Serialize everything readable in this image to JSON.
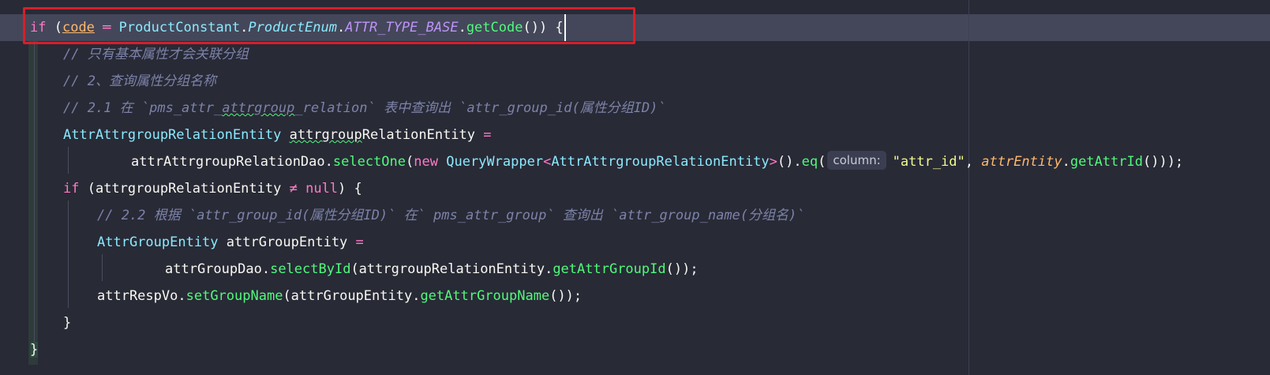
{
  "editor": {
    "lines": [
      {
        "indent": 38,
        "tokens": [
          {
            "text": "if",
            "cls": "kw"
          },
          {
            "text": " (",
            "cls": "plain"
          },
          {
            "text": "code",
            "cls": "var-code"
          },
          {
            "text": " ═ ",
            "cls": "kw"
          },
          {
            "text": "ProductConstant",
            "cls": "cls"
          },
          {
            "text": ".",
            "cls": "plain"
          },
          {
            "text": "ProductEnum",
            "cls": "cls-it"
          },
          {
            "text": ".",
            "cls": "plain"
          },
          {
            "text": "ATTR_TYPE_BASE",
            "cls": "fld"
          },
          {
            "text": ".",
            "cls": "plain"
          },
          {
            "text": "getCode",
            "cls": "fn"
          },
          {
            "text": "()) ",
            "cls": "plain"
          },
          {
            "text": "{",
            "cls": "caret-brace"
          }
        ]
      },
      {
        "indent": 80,
        "tokens": [
          {
            "text": "// 只有基本属性才会关联分组",
            "cls": "cmt"
          }
        ]
      },
      {
        "indent": 80,
        "tokens": [
          {
            "text": "// 2、查询属性分组名称",
            "cls": "cmt"
          }
        ]
      },
      {
        "indent": 80,
        "tokens": [
          {
            "text": "// 2.1 在 `pms_attr_",
            "cls": "cmt"
          },
          {
            "text": "attrgroup",
            "cls": "cmt typo"
          },
          {
            "text": "_relation` 表中查询出 `attr_group_id(属性分组ID)`",
            "cls": "cmt"
          }
        ]
      },
      {
        "indent": 80,
        "tokens": [
          {
            "text": "AttrAttrgroupRelationEntity",
            "cls": "cls"
          },
          {
            "text": " ",
            "cls": "plain"
          },
          {
            "text": "attrgroup",
            "cls": "plain typo"
          },
          {
            "text": "RelationEntity",
            "cls": "plain"
          },
          {
            "text": " =",
            "cls": "kw"
          }
        ]
      },
      {
        "indent": 166,
        "tokens": [
          {
            "text": "attrAttrgroupRelationDao",
            "cls": "plain"
          },
          {
            "text": ".",
            "cls": "plain"
          },
          {
            "text": "selectOne",
            "cls": "fn"
          },
          {
            "text": "(",
            "cls": "plain"
          },
          {
            "text": "new",
            "cls": "kw"
          },
          {
            "text": " ",
            "cls": "plain"
          },
          {
            "text": "QueryWrapper",
            "cls": "cls"
          },
          {
            "text": "<",
            "cls": "kw"
          },
          {
            "text": "AttrAttrgroupRelationEntity",
            "cls": "cls"
          },
          {
            "text": ">",
            "cls": "kw"
          },
          {
            "text": "().",
            "cls": "plain"
          },
          {
            "text": "eq",
            "cls": "fn"
          },
          {
            "text": "(",
            "cls": "plain"
          },
          {
            "text": "column:",
            "cls": "hint"
          },
          {
            "text": "\"attr_id\"",
            "cls": "str"
          },
          {
            "text": ", ",
            "cls": "plain"
          },
          {
            "text": "attrEntity",
            "cls": "par"
          },
          {
            "text": ".",
            "cls": "plain"
          },
          {
            "text": "getAttrId",
            "cls": "fn"
          },
          {
            "text": "()));",
            "cls": "plain"
          }
        ]
      },
      {
        "indent": 80,
        "tokens": [
          {
            "text": "if",
            "cls": "kw"
          },
          {
            "text": " (attrgroupRelationEntity ",
            "cls": "plain"
          },
          {
            "text": "≠",
            "cls": "kw"
          },
          {
            "text": " ",
            "cls": "plain"
          },
          {
            "text": "null",
            "cls": "kw"
          },
          {
            "text": ") {",
            "cls": "plain"
          }
        ]
      },
      {
        "indent": 123,
        "tokens": [
          {
            "text": "// 2.2 根据 `attr_group_id(属性分组ID)` 在` pms_attr_group` 查询出 `attr_group_name(分组名)`",
            "cls": "cmt"
          }
        ]
      },
      {
        "indent": 123,
        "tokens": [
          {
            "text": "AttrGroupEntity",
            "cls": "cls"
          },
          {
            "text": " attrGroupEntity",
            "cls": "plain"
          },
          {
            "text": " =",
            "cls": "kw"
          }
        ]
      },
      {
        "indent": 209,
        "tokens": [
          {
            "text": "attrGroupDao",
            "cls": "plain"
          },
          {
            "text": ".",
            "cls": "plain"
          },
          {
            "text": "selectById",
            "cls": "fn"
          },
          {
            "text": "(attrgroupRelationEntity.",
            "cls": "plain"
          },
          {
            "text": "getAttrGroupId",
            "cls": "fn"
          },
          {
            "text": "());",
            "cls": "plain"
          }
        ]
      },
      {
        "indent": 123,
        "tokens": [
          {
            "text": "attrRespVo",
            "cls": "plain"
          },
          {
            "text": ".",
            "cls": "plain"
          },
          {
            "text": "setGroupName",
            "cls": "fn"
          },
          {
            "text": "(attrGroupEntity.",
            "cls": "plain"
          },
          {
            "text": "getAttrGroupName",
            "cls": "fn"
          },
          {
            "text": "());",
            "cls": "plain"
          }
        ]
      },
      {
        "indent": 80,
        "tokens": [
          {
            "text": "}",
            "cls": "plain"
          }
        ]
      },
      {
        "indent": 38,
        "tokens": [
          {
            "text": "}",
            "cls": "closing-brace"
          }
        ]
      }
    ]
  },
  "colors": {
    "background": "#282a36",
    "current_line": "#44475a",
    "highlight_box": "#d4202a",
    "keyword": "#ff79c6",
    "class": "#8be9fd",
    "field": "#bd93f9",
    "function": "#50fa7b",
    "string": "#f1fa8c",
    "comment": "#7d82a8",
    "parameter": "#ffb86c"
  }
}
